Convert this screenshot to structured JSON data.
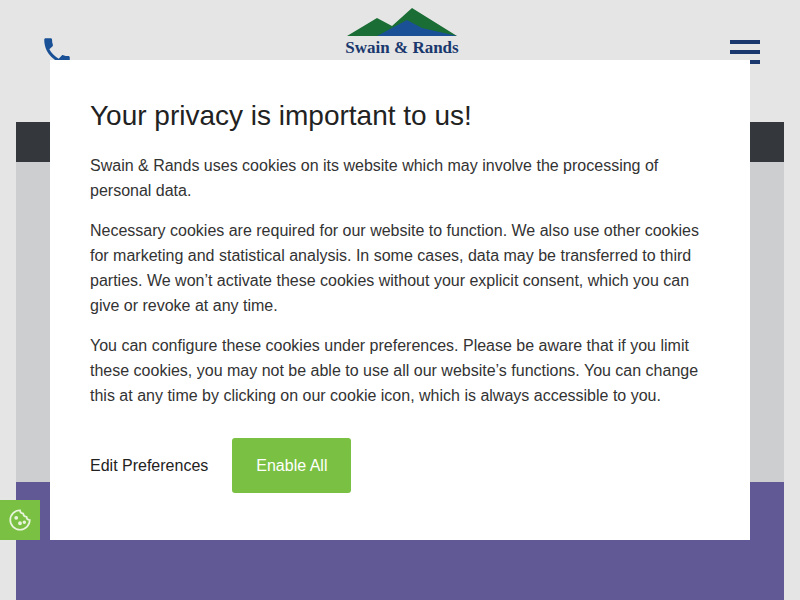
{
  "header": {
    "logo": "Swain & Rands"
  },
  "modal": {
    "title": "Your privacy is important to us!",
    "paragraphs": [
      "Swain & Rands uses cookies on its website which may involve the processing of personal data.",
      "Necessary cookies are required for our website to function. We also use other cookies for marketing and statistical analysis. In some cases, data may be transferred to third parties. We won’t activate these cookies without your explicit consent, which you can give or revoke at any time.",
      "You can configure these cookies under preferences. Please be aware that if you limit these cookies, you may not be able to use all our website’s functions. You can change this at any time by clicking on our cookie icon, which is always accessible to you."
    ],
    "buttons": [
      {
        "label": "Edit Preferences",
        "kind": "link"
      },
      {
        "label": "Enable All",
        "kind": "primary"
      }
    ]
  }
}
